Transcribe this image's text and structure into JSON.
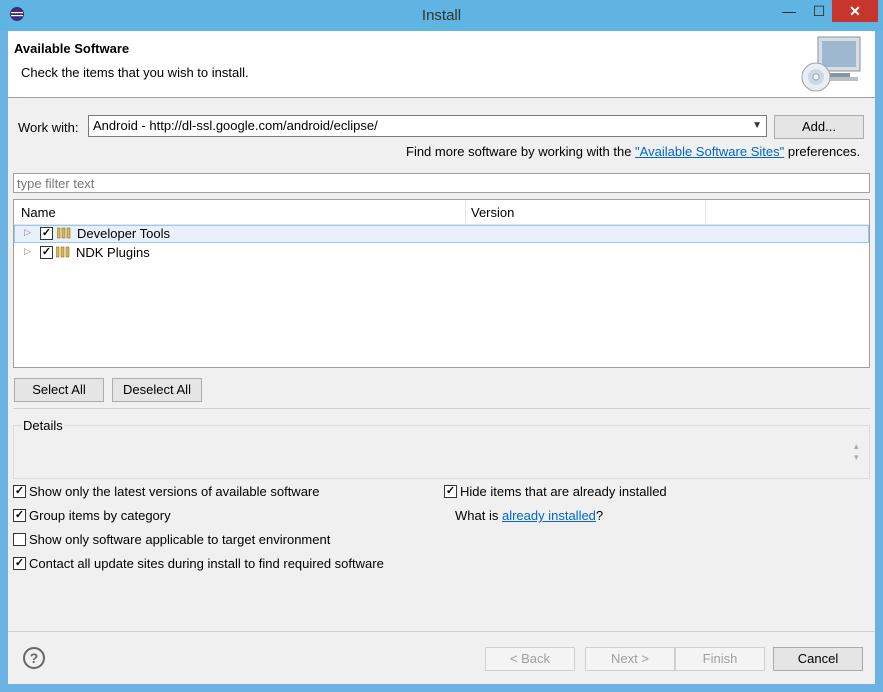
{
  "window": {
    "title": "Install",
    "min": "—",
    "max": "☐",
    "close": "✕"
  },
  "header": {
    "title": "Available Software",
    "description": "Check the items that you wish to install."
  },
  "work_with": {
    "label": "Work with:",
    "value": "Android - http://dl-ssl.google.com/android/eclipse/",
    "add_label": "Add..."
  },
  "find_more": {
    "prefix": "Find more software by working with the ",
    "link": "\"Available Software Sites\"",
    "suffix": " preferences."
  },
  "filter": {
    "placeholder": "type filter text"
  },
  "tree": {
    "columns": [
      "Name",
      "Version"
    ],
    "rows": [
      {
        "label": "Developer Tools",
        "checked": true,
        "selected": true
      },
      {
        "label": "NDK Plugins",
        "checked": true,
        "selected": false
      }
    ]
  },
  "buttons": {
    "select_all": "Select All",
    "deselect_all": "Deselect All"
  },
  "details": {
    "label": "Details"
  },
  "options": {
    "latest_versions": "Show only the latest versions of available software",
    "group_by_category": "Group items by category",
    "applicable_only": "Show only software applicable to target environment",
    "contact_all": "Contact all update sites during install to find required software",
    "hide_installed": "Hide items that are already installed",
    "what_is_prefix": "What is ",
    "what_is_link": "already installed",
    "what_is_suffix": "?"
  },
  "footer": {
    "help": "?",
    "back": "< Back",
    "next": "Next >",
    "finish": "Finish",
    "cancel": "Cancel"
  },
  "colors": {
    "accent": "#60b4e2",
    "close": "#c7362d",
    "link": "#0066cc"
  }
}
